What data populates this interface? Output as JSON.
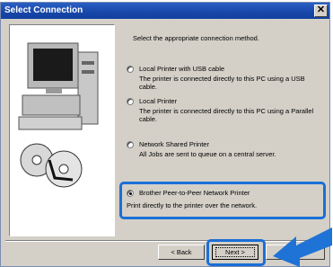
{
  "window": {
    "title": "Select Connection",
    "close_glyph": "✕"
  },
  "instruction": "Select the appropriate connection method.",
  "options": [
    {
      "label": "Local Printer with USB cable",
      "desc": "The printer is connected directly to this PC using a USB cable.",
      "selected": false
    },
    {
      "label": "Local Printer",
      "desc": "The printer is connected directly to this PC using a Parallel cable.",
      "selected": false
    },
    {
      "label": "Network Shared Printer",
      "desc": "All Jobs are sent to queue on a central server.",
      "selected": false
    },
    {
      "label": "Brother Peer-to-Peer Network Printer",
      "desc": "Print directly to the printer over the network.",
      "selected": true
    }
  ],
  "buttons": {
    "back": "< Back",
    "next": "Next >",
    "cancel": ""
  },
  "colors": {
    "titlebar": "#1847a8",
    "highlight": "#1b6fd6",
    "arrow": "#1f73d6"
  },
  "icons": {
    "illustration": "computer-and-cd-icon",
    "pointer": "arrow-pointer-icon"
  }
}
